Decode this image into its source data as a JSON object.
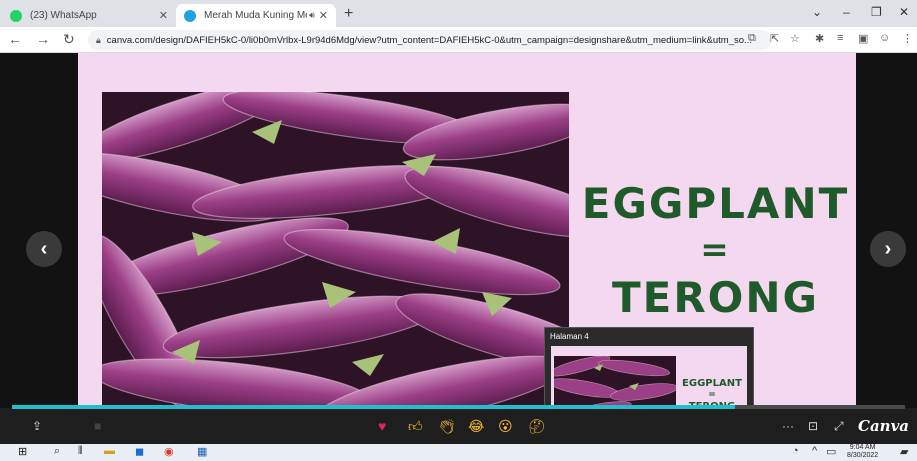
{
  "browser": {
    "tabs": [
      {
        "label": "(23) WhatsApp",
        "favicon": "whatsapp-icon",
        "favicon_color": "#25d366"
      },
      {
        "label": "Merah Muda Kuning Merah",
        "favicon": "canva-icon",
        "favicon_color": "#1fa3e0"
      }
    ],
    "url": "canva.com/design/DAFIEH5kC-0/li0b0mVrlbx-L9r94d6Mdg/view?utm_content=DAFIEH5kC-0&utm_campaign=designshare&utm_medium=link&utm_so..."
  },
  "slide": {
    "heading_line1": "EGGPLANT",
    "heading_line2": "=",
    "heading_line3": "TERONG"
  },
  "preview": {
    "label": "Halaman 4",
    "heading_line1": "EGGPLANT",
    "heading_line2": "=",
    "heading_line3": "TERONG"
  },
  "player": {
    "progress": 0.81,
    "brand": "Canva",
    "reactions": [
      "heart-icon",
      "thumbs-up-icon",
      "clap-icon",
      "laugh-icon",
      "surprised-icon",
      "thinking-icon"
    ],
    "accent_color": "#1fbfcf"
  },
  "taskbar": {
    "time": "9:04 AM",
    "date": "8/30/2022"
  },
  "colors": {
    "slide_bg": "#f3d8ef",
    "heading": "#1f5a2a"
  }
}
